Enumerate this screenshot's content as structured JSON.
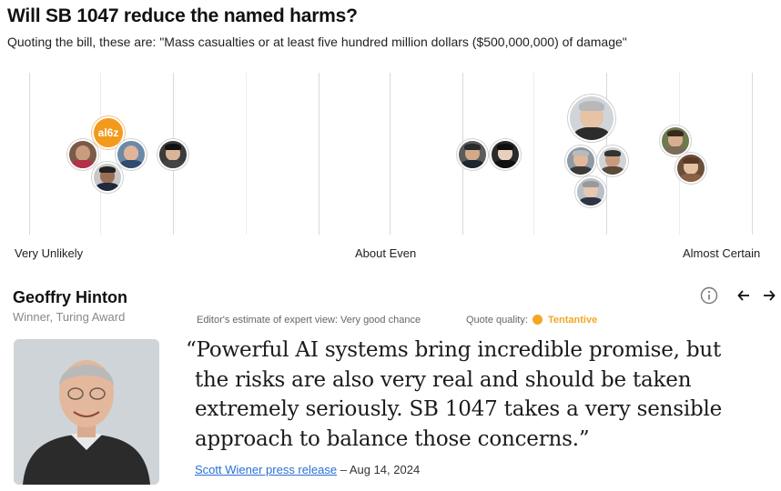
{
  "header": {
    "title": "Will SB 1047 reduce the named harms?",
    "subtitle": "Quoting the bill, these are: \"Mass casualties or at least five hundred million dollars ($500,000,000) of damage\""
  },
  "scale": {
    "labels": {
      "left": "Very Unlikely",
      "middle": "About Even",
      "right": "Almost Certain"
    },
    "a16z_label": "al6z"
  },
  "detail": {
    "name": "Geoffry Hinton",
    "role": "Winner, Turing Award",
    "editor_estimate": "Editor's estimate of expert view: Very good chance",
    "quality_label": "Quote quality:",
    "quality_value": "Tentantive",
    "quote": "“Powerful AI systems bring incredible promise, but the risks are also very real and should be taken extremely seriously. SB 1047 takes a very sensible approach to balance those concerns.”",
    "source_link": "Scott Wiener press release",
    "source_date": "– Aug 14, 2024"
  },
  "colors": {
    "accent_orange": "#f5a623",
    "link_blue": "#2a6fd6"
  },
  "icons": {
    "info": "info-icon",
    "prev": "arrow-left-icon",
    "next": "arrow-right-icon"
  }
}
